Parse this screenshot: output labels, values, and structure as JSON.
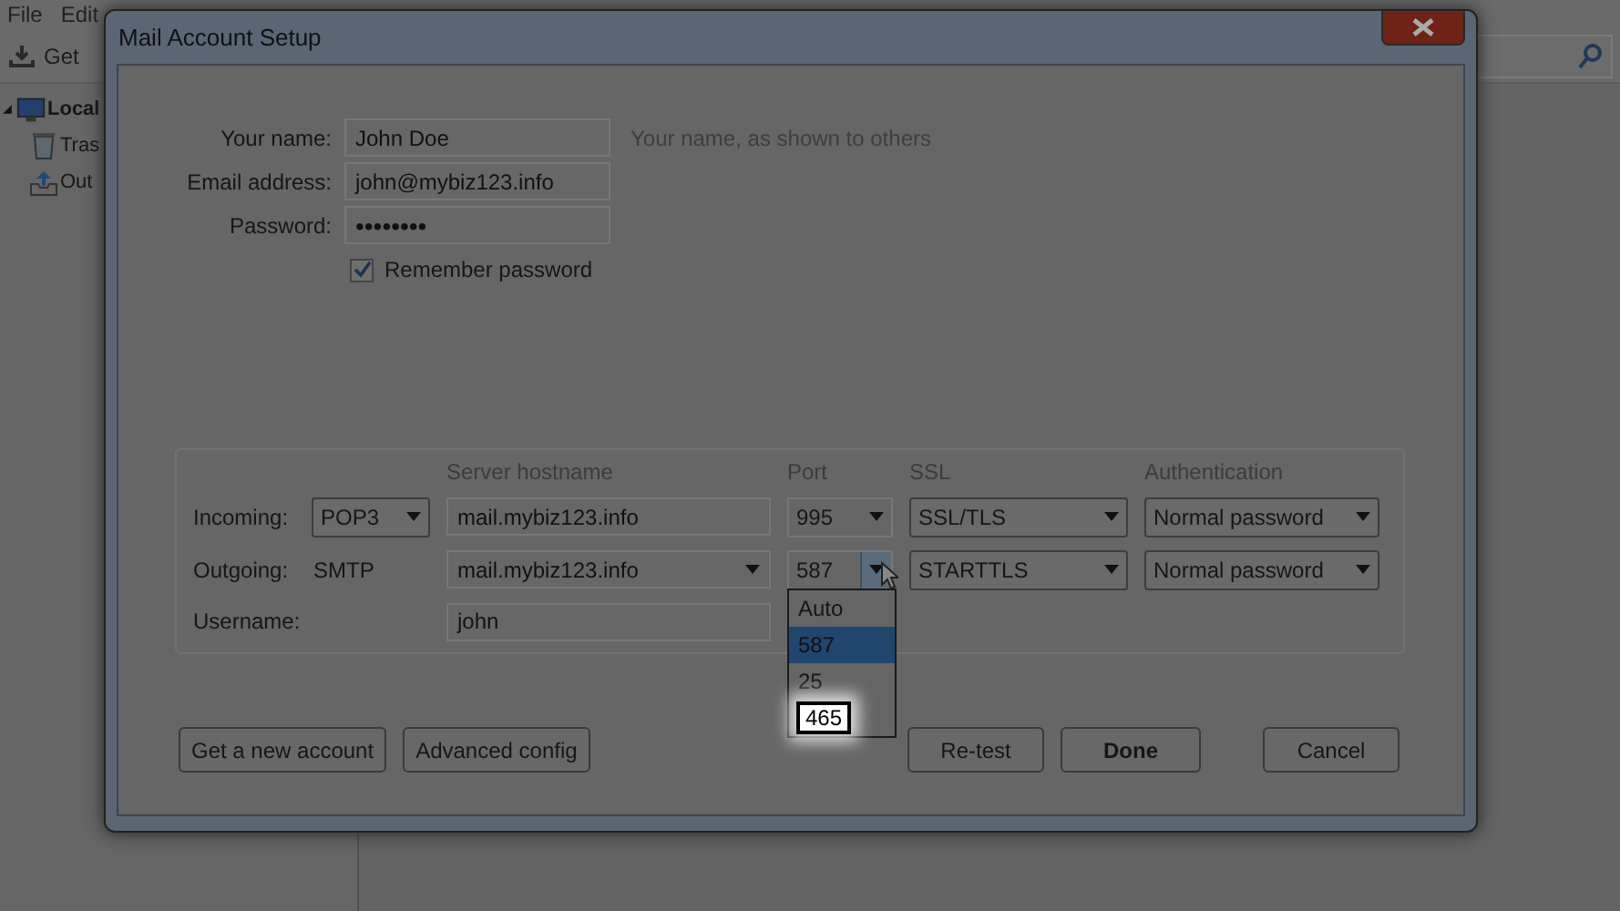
{
  "app": {
    "menu": [
      "File",
      "Edit"
    ],
    "toolbar": {
      "get_mail": "Get"
    },
    "folders": [
      {
        "label": "Local",
        "expanded": true,
        "selected": true,
        "children": [
          {
            "label": "Tras"
          },
          {
            "label": "Out"
          }
        ]
      }
    ]
  },
  "dialog": {
    "title": "Mail Account Setup",
    "fields": [
      {
        "label": "Your name:",
        "value": "John Doe",
        "hint": "Your name, as shown to others",
        "kind": "text"
      },
      {
        "label": "Email address:",
        "value": "john@mybiz123.info",
        "kind": "text"
      },
      {
        "label": "Password:",
        "value": "••••••••",
        "kind": "password"
      }
    ],
    "remember": {
      "label": "Remember password",
      "checked": true
    },
    "servers": {
      "headers": [
        "Server hostname",
        "Port",
        "SSL",
        "Authentication"
      ],
      "rows": [
        {
          "label": "Incoming:",
          "cells": [
            {
              "kind": "select",
              "value": "POP3"
            },
            {
              "kind": "field",
              "value": "mail.mybiz123.info"
            },
            {
              "kind": "select",
              "value": "995"
            },
            {
              "kind": "select",
              "value": "SSL/TLS"
            },
            {
              "kind": "select",
              "value": "Normal password"
            }
          ]
        },
        {
          "label": "Outgoing:",
          "cells": [
            {
              "kind": "text",
              "value": "SMTP"
            },
            {
              "kind": "combo",
              "value": "mail.mybiz123.info"
            },
            {
              "kind": "select",
              "value": "587",
              "open": true,
              "options": [
                {
                  "label": "Auto",
                  "selected": false,
                  "highlighted": false
                },
                {
                  "label": "587",
                  "selected": true,
                  "highlighted": false
                },
                {
                  "label": "25",
                  "selected": false,
                  "highlighted": false
                },
                {
                  "label": "465",
                  "selected": false,
                  "highlighted": true
                }
              ]
            },
            {
              "kind": "select",
              "value": "STARTTLS"
            },
            {
              "kind": "select",
              "value": "Normal password"
            }
          ]
        },
        {
          "label": "Username:",
          "cells": [
            {
              "kind": "empty"
            },
            {
              "kind": "field",
              "value": "john"
            }
          ]
        }
      ]
    },
    "left_buttons": [
      "Get a new account",
      "Advanced config"
    ],
    "right_buttons": [
      {
        "label": "Re-test",
        "default": false
      },
      {
        "label": "Done",
        "default": true
      },
      {
        "label": "Cancel",
        "default": false
      }
    ]
  }
}
